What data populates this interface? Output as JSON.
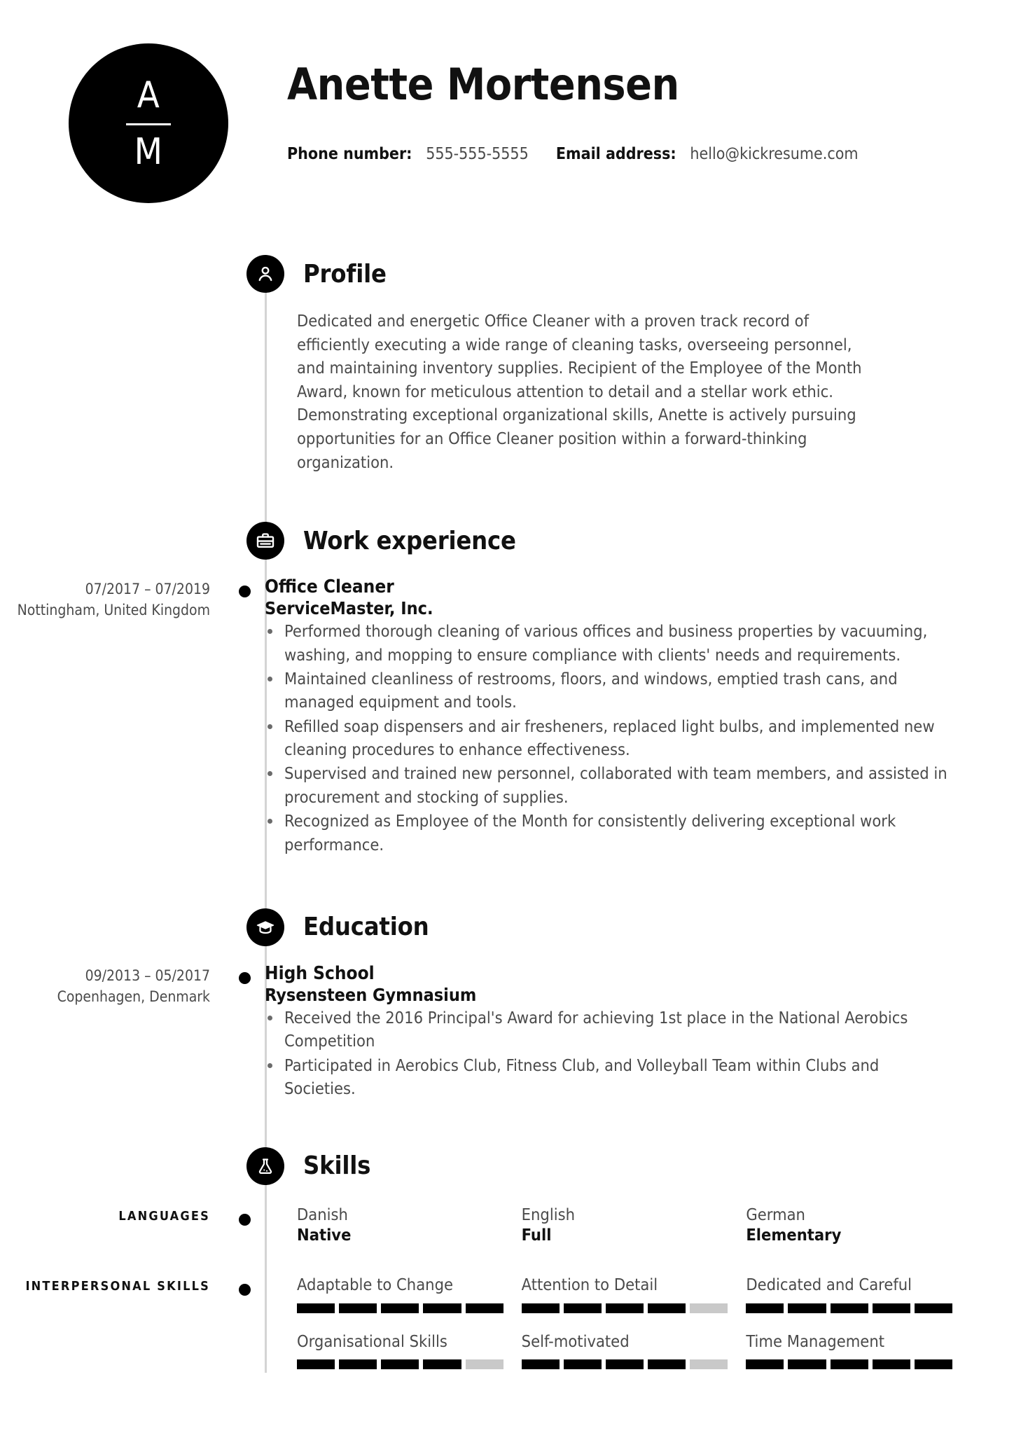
{
  "header": {
    "monogram": {
      "first_initial": "A",
      "last_initial": "M"
    },
    "name": "Anette Mortensen",
    "phone_label": "Phone number:",
    "phone_value": "555-555-5555",
    "email_label": "Email address:",
    "email_value": "hello@kickresume.com"
  },
  "sections": {
    "profile": {
      "title": "Profile",
      "icon": "person-icon",
      "text": "Dedicated and energetic Office Cleaner with a proven track record of efficiently executing a wide range of cleaning tasks, overseeing personnel, and maintaining inventory supplies. Recipient of the Employee of the Month Award, known for meticulous attention to detail and a stellar work ethic. Demonstrating exceptional organizational skills, Anette is actively pursuing opportunities for an Office Cleaner position within a forward-thinking organization."
    },
    "work": {
      "title": "Work experience",
      "icon": "briefcase-icon",
      "entry": {
        "date": "07/2017 – 07/2019",
        "location": "Nottingham, United Kingdom",
        "job_title": "Office Cleaner",
        "organisation": "ServiceMaster, Inc.",
        "bullets": [
          "Performed thorough cleaning of various offices and business properties by vacuuming, washing, and mopping to ensure compliance with clients' needs and requirements.",
          "Maintained cleanliness of restrooms, floors, and windows, emptied trash cans, and managed equipment and tools.",
          "Refilled soap dispensers and air fresheners, replaced light bulbs, and implemented new cleaning procedures to enhance effectiveness.",
          "Supervised and trained new personnel, collaborated with team members, and assisted in procurement and stocking of supplies.",
          "Recognized as Employee of the Month for consistently delivering exceptional work performance."
        ]
      }
    },
    "education": {
      "title": "Education",
      "icon": "graduation-cap-icon",
      "entry": {
        "date": "09/2013 – 05/2017",
        "location": "Copenhagen, Denmark",
        "degree": "High School",
        "organisation": "Rysensteen Gymnasium",
        "bullets": [
          "Received the 2016 Principal's Award for achieving 1st place in the National Aerobics Competition",
          "Participated in Aerobics Club, Fitness Club, and Volleyball Team within Clubs and Societies."
        ]
      }
    },
    "skills": {
      "title": "Skills",
      "icon": "flask-icon",
      "languages": {
        "label": "LANGUAGES",
        "items": [
          {
            "name": "Danish",
            "level": "Native"
          },
          {
            "name": "English",
            "level": "Full"
          },
          {
            "name": "German",
            "level": "Elementary"
          }
        ]
      },
      "interpersonal": {
        "label": "INTERPERSONAL SKILLS",
        "max_rating": 5,
        "items": [
          {
            "name": "Adaptable to Change",
            "rating": 5
          },
          {
            "name": "Attention to Detail",
            "rating": 4
          },
          {
            "name": "Dedicated and Careful",
            "rating": 5
          },
          {
            "name": "Organisational Skills",
            "rating": 4
          },
          {
            "name": "Self-motivated",
            "rating": 4
          },
          {
            "name": "Time Management",
            "rating": 5
          }
        ]
      }
    }
  },
  "colors": {
    "ink": "#111111",
    "body_text": "#4a4a4a",
    "accent": "#000000",
    "rail": "#d4d4d4",
    "rating_off": "#c9c9c9"
  }
}
